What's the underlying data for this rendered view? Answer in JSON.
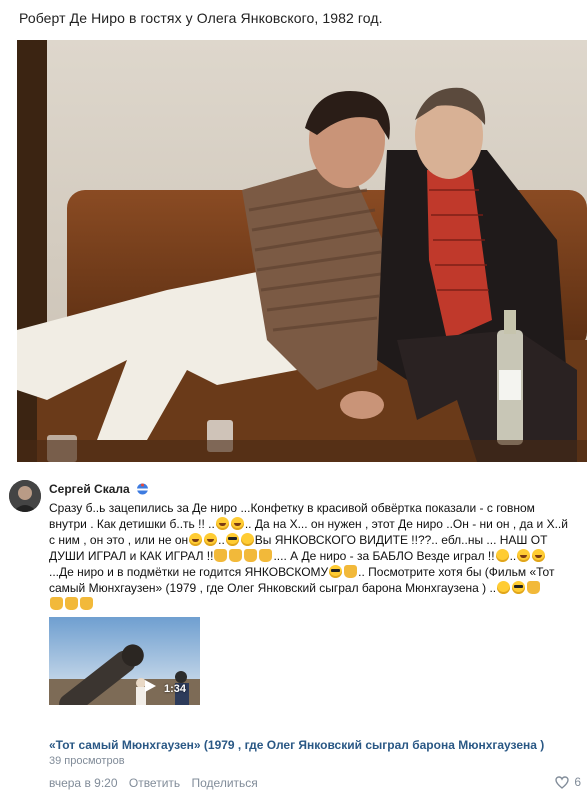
{
  "post": {
    "title": "Роберт Де Ниро в гостях у Олега Янковского, 1982 год."
  },
  "comment": {
    "author": "Сергей Скала",
    "lines": [
      "Сразу б..ь зацепились за Де ниро ...Конфетку в красивой обвёртка показали - с говном",
      "внутри . Как детишки б..ть !! ..",
      ".. Да на Х... он нужен , этот Де ниро ..Он - ни он , да и Х..й",
      "с ним , он это , или не он",
      "..",
      "Вы ЯНКОВСКОГО ВИДИТЕ !!??.. ебл..ны ... НАШ ОТ",
      "ДУШИ ИГРАЛ и КАК ИГРАЛ !!",
      ".... А Де ниро - за БАБЛО Везде играл !!",
      "..",
      "...Де ниро и в подмётки не годится ЯНКОВСКОМУ",
      ".. Посмотрите хотя бы (Фильм «Тот",
      "самый Мюнхгаузен» (1979 , где Олег Янковский сыграл барона Мюнхгаузена ) .."
    ]
  },
  "video": {
    "duration": "1:34",
    "title": "«Тот самый Мюнхгаузен» (1979 , где Олег Янковский сыграл барона Мюнхгаузена )",
    "views": "39 просмотров"
  },
  "footer": {
    "time": "вчера в 9:20",
    "reply": "Ответить",
    "share": "Поделиться",
    "likes": "6"
  },
  "icons": {
    "avatar": "avatar-image",
    "play": "play-icon",
    "heart": "heart-icon"
  },
  "colors": {
    "link": "#2a5885",
    "muted": "#818c99"
  }
}
